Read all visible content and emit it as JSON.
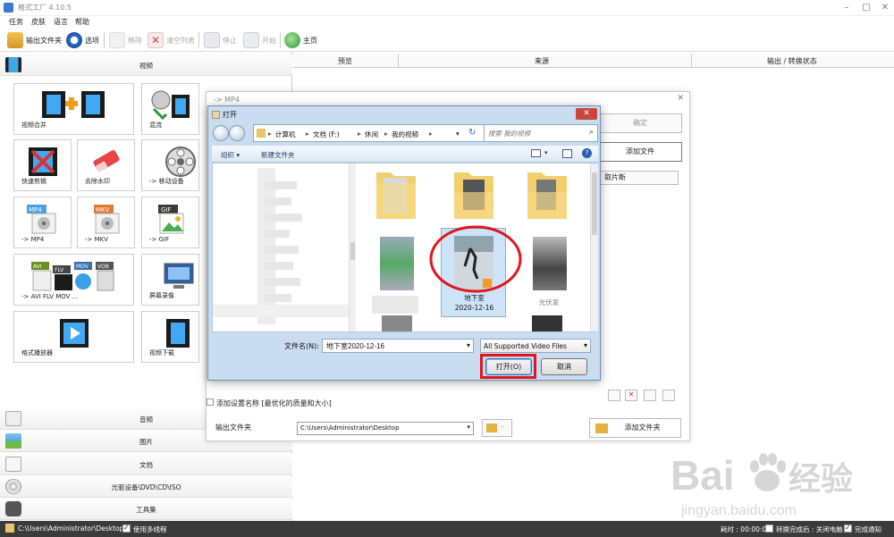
{
  "window": {
    "title": "格式工厂 4.10.5"
  },
  "menu": [
    "任务",
    "皮肤",
    "语言",
    "帮助"
  ],
  "toolbar": {
    "output_folder": "输出文件夹",
    "options": "选项",
    "remove": "移除",
    "clear_list": "清空列表",
    "stop": "停止",
    "start": "开始",
    "home": "主页"
  },
  "left": {
    "video_header": "视频",
    "tiles": [
      "视频合并",
      "混流",
      "快速剪辑",
      "去除水印",
      "-> 移动设备",
      "-> MP4",
      "-> MKV",
      "-> GIF",
      "-> AVI FLV MOV ...",
      "屏幕录像",
      "格式播放器",
      "视频下载"
    ],
    "tile_icon_texts": {
      "mp4": "MP4",
      "mkv": "MKV",
      "gif": "GIF",
      "avi": "AVI",
      "flv": "FLV",
      "mov": "MOV",
      "vob": "VOB"
    },
    "categories": [
      "音频",
      "图片",
      "文档",
      "光驱设备\\DVD\\CD\\ISO",
      "工具集"
    ]
  },
  "columns": [
    "预览",
    "来源",
    "输出 / 转换状态"
  ],
  "mp4_dialog": {
    "title": "-> MP4",
    "ok": "确定",
    "add_file": "添加文件",
    "clip": "取片断",
    "add_setting_name": "添加设置名称 [最优化的质量和大小]",
    "output_folder_label": "输出文件夹",
    "output_path": "C:\\Users\\Administrator\\Desktop",
    "add_folder": "添加文件夹"
  },
  "open_dialog": {
    "title": "打开",
    "path": [
      "计算机",
      "文档 (F:)",
      "休闲",
      "我的视频"
    ],
    "search_placeholder": "搜索 我的视频",
    "organize": "组织 ▾",
    "new_folder": "新建文件夹",
    "selected_file": {
      "name": "地下室",
      "date": "2020-12-16"
    },
    "blurred_label": "光伏发",
    "filename_label": "文件名(N):",
    "filename_value": "地下室2020-12-16",
    "filetype": "All Supported Video Files",
    "open": "打开(O)",
    "cancel": "取消"
  },
  "status": {
    "path": "C:\\Users\\Administrator\\Desktop",
    "multithread": "使用多线程",
    "elapsed": "耗时 : 00:00:00",
    "after_convert": "转换完成后 : 关闭电脑",
    "notify": "完成通知"
  },
  "watermark": {
    "brand": "Bai",
    "cn": "经验",
    "url": "jingyan.baidu.com"
  },
  "colors": {
    "highlight_red": "#e0151b",
    "status_bg": "#3b3b3b",
    "dialog_frame": "#c9dcf0"
  }
}
